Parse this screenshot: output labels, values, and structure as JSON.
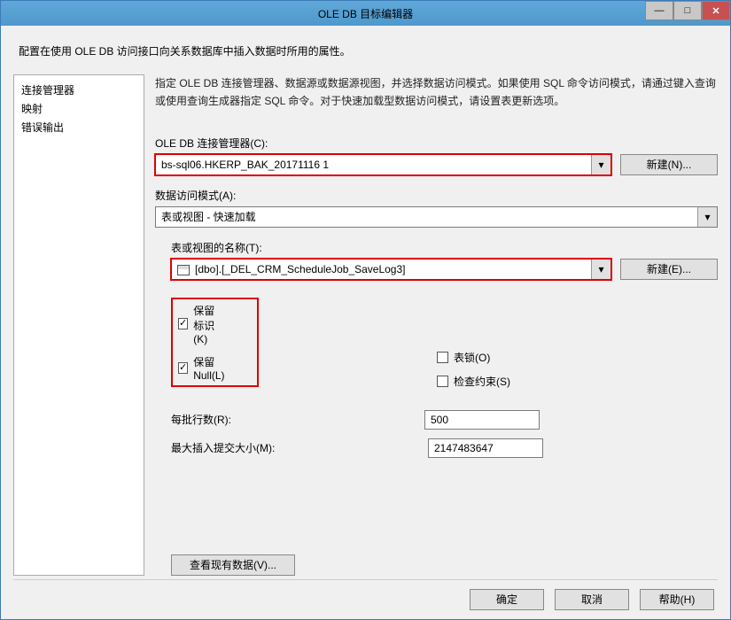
{
  "window": {
    "title": "OLE DB 目标编辑器"
  },
  "description": "配置在使用 OLE DB 访问接口向关系数据库中插入数据时所用的属性。",
  "nav": {
    "items": [
      "连接管理器",
      "映射",
      "错误输出"
    ]
  },
  "instruction": "指定 OLE DB 连接管理器、数据源或数据源视图，并选择数据访问模式。如果使用 SQL 命令访问模式，请通过键入查询或使用查询生成器指定 SQL 命令。对于快速加载型数据访问模式，请设置表更新选项。",
  "cm": {
    "label": "OLE DB 连接管理器(C):",
    "value": "bs-sql06.HKERP_BAK_20171116 1",
    "new_btn": "新建(N)..."
  },
  "mode": {
    "label": "数据访问模式(A):",
    "value": "表或视图 - 快速加载"
  },
  "table": {
    "label": "表或视图的名称(T):",
    "value": "[dbo].[_DEL_CRM_ScheduleJob_SaveLog3]",
    "new_btn": "新建(E)..."
  },
  "opts": {
    "keep_identity": "保留标识(K)",
    "keep_nulls": "保留 Null(L)",
    "table_lock": "表锁(O)",
    "check_constraints": "检查约束(S)",
    "keep_identity_checked": "✓",
    "keep_nulls_checked": "✓",
    "table_lock_checked": "",
    "check_constraints_checked": ""
  },
  "batch": {
    "rows_label": "每批行数(R):",
    "rows_value": "500",
    "max_label": "最大插入提交大小(M):",
    "max_value": "2147483647"
  },
  "view_btn": "查看现有数据(V)...",
  "footer": {
    "ok": "确定",
    "cancel": "取消",
    "help": "帮助(H)"
  },
  "watermark": ""
}
